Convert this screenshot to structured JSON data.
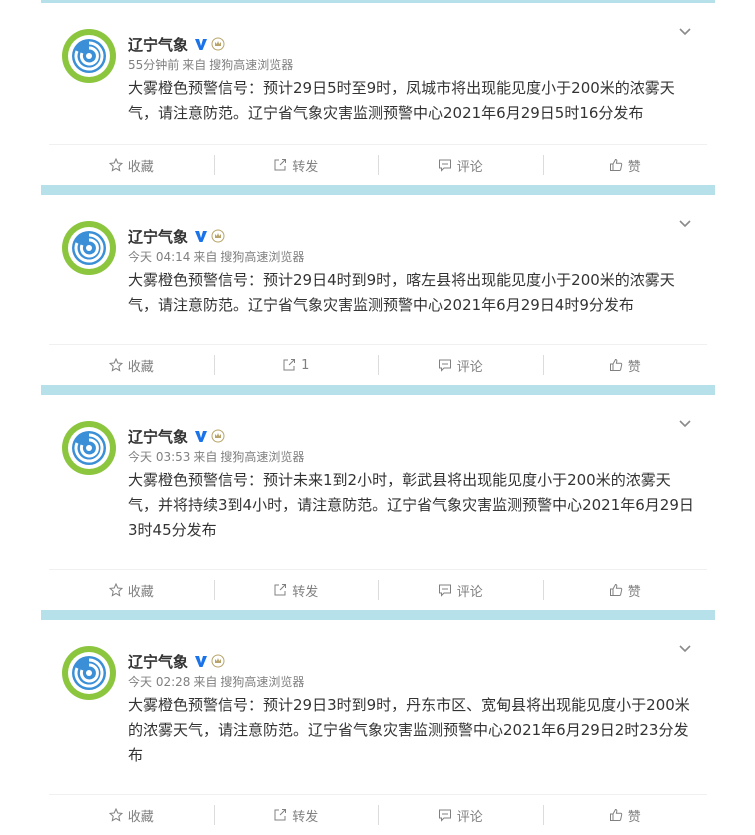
{
  "posts": [
    {
      "author": "辽宁气象",
      "time": "55分钟前",
      "from": "来自",
      "source": "搜狗高速浏览器",
      "text": "大雾橙色预警信号：预计29日5时至9时，凤城市将出现能见度小于200米的浓雾天气，请注意防范。辽宁省气象灾害监测预警中心2021年6月29日5时16分发布",
      "actions": {
        "favorite": "收藏",
        "forward": "转发",
        "comment": "评论",
        "like": "赞"
      }
    },
    {
      "author": "辽宁气象",
      "time": "今天 04:14",
      "from": "来自",
      "source": "搜狗高速浏览器",
      "text": "大雾橙色预警信号：预计29日4时到9时，喀左县将出现能见度小于200米的浓雾天气，请注意防范。辽宁省气象灾害监测预警中心2021年6月29日4时9分发布",
      "actions": {
        "favorite": "收藏",
        "forward": "1",
        "comment": "评论",
        "like": "赞"
      }
    },
    {
      "author": "辽宁气象",
      "time": "今天 03:53",
      "from": "来自",
      "source": "搜狗高速浏览器",
      "text": "大雾橙色预警信号：预计未来1到2小时，彰武县将出现能见度小于200米的浓雾天气，并将持续3到4小时，请注意防范。辽宁省气象灾害监测预警中心2021年6月29日3时45分发布",
      "actions": {
        "favorite": "收藏",
        "forward": "转发",
        "comment": "评论",
        "like": "赞"
      }
    },
    {
      "author": "辽宁气象",
      "time": "今天 02:28",
      "from": "来自",
      "source": "搜狗高速浏览器",
      "text": "大雾橙色预警信号：预计29日3时到9时，丹东市区、宽甸县将出现能见度小于200米的浓雾天气，请注意防范。辽宁省气象灾害监测预警中心2021年6月29日2时23分发布",
      "actions": {
        "favorite": "收藏",
        "forward": "转发",
        "comment": "评论",
        "like": "赞"
      }
    }
  ],
  "colors": {
    "separator": "#b7e1ea",
    "verified": "#1a73e8",
    "avatar_green": "#8cc63f",
    "avatar_blue": "#3b8fd6"
  }
}
